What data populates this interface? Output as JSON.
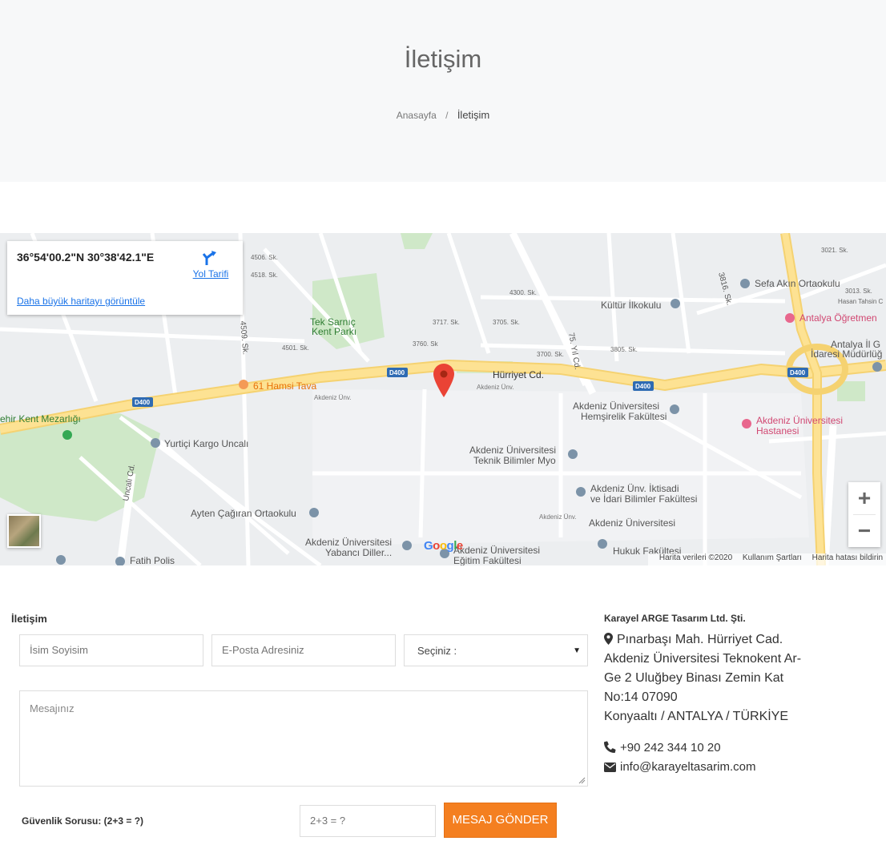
{
  "header": {
    "title": "İletişim",
    "breadcrumb": {
      "home": "Anasayfa",
      "separator": "/",
      "current": "İletişim"
    }
  },
  "map": {
    "coordinates": "36°54'00.2\"N 30°38'42.1\"E",
    "directions_label": "Yol Tarifi",
    "larger_map_link": "Daha büyük haritayı görüntüle",
    "zoom_in": "+",
    "zoom_out": "−",
    "google_logo": "Google",
    "footer": {
      "map_data": "Harita verileri ©2020",
      "terms": "Kullanım Şartları",
      "report": "Harita hatası bildirin"
    },
    "labels": {
      "road_hurriyet": "Hürriyet Cd.",
      "d400": "D400",
      "tek_sarnic": "Tek Sarnıç",
      "kent_parki": "Kent Parkı",
      "hamsi": "61 Hamsi Tava",
      "sefa": "Sefa Akın Ortaokulu",
      "kultur": "Kültür İlkokulu",
      "ogretmen": "Antalya Öğretmen",
      "il_genel": "Antalya İl G",
      "idaresi": "İdaresi Müdürlüğ",
      "hemsirelik_1": "Akdeniz Üniversitesi",
      "hemsirelik_2": "Hemşirelik Fakültesi",
      "hastanesi_1": "Akdeniz Üniversitesi",
      "hastanesi_2": "Hastanesi",
      "teknik_1": "Akdeniz Üniversitesi",
      "teknik_2": "Teknik Bilimler Myo",
      "iktisadi_1": "Akdeniz Ünv. İktisadi",
      "iktisadi_2": "ve İdari Bilimler Fakültesi",
      "hukuk_1": "Akdeniz Üniversitesi",
      "hukuk_2": "Hukuk Fakültesi",
      "yabanci_1": "Akdeniz Üniversitesi",
      "yabanci_2": "Yabancı Diller...",
      "egitim_1": "Akdeniz Üniversitesi",
      "egitim_2": "Eğitim Fakültesi",
      "yurtici": "Yurtiçi Kargo Uncalı",
      "ayten": "Ayten Çağıran Ortaokulu",
      "fatih": "Fatih Polis",
      "mezarlik": "ehir Kent Mezarlığı",
      "uncali": "Uncalı Cd.",
      "sk4509": "4509. Sk.",
      "sk3816": "3816. Sk.",
      "yil75": "75. Yıl Cd.",
      "sk4506": "4506. Sk.",
      "sk4518": "4518. Sk.",
      "sk3760": "3760. Sk",
      "sk3700": "3700. Sk.",
      "sk3805": "3805. Sk.",
      "sk4501": "4501. Sk.",
      "sk3705": "3705. Sk.",
      "sk3717": "3717. Sk.",
      "sk4300": "4300. Sk.",
      "sk3021": "3021. Sk.",
      "sk3013": "3013. Sk.",
      "hasan": "Hasan Tahsin C",
      "akdeniz_unv": "Akdeniz Ünv."
    }
  },
  "form": {
    "heading": "İletişim",
    "name_placeholder": "İsim Soyisim",
    "email_placeholder": "E-Posta Adresiniz",
    "select_value": "Seçiniz :",
    "message_placeholder": "Mesajınız",
    "security_label": "Güvenlik Sorusu: (2+3 = ?)",
    "captcha_placeholder": "2+3 = ?",
    "submit_label": "MESAJ GÖNDER"
  },
  "company": {
    "name": "Karayel ARGE Tasarım Ltd. Şti.",
    "address_line1": "Pınarbaşı Mah. Hürriyet Cad.",
    "address_line2": "Akdeniz Üniversitesi Teknokent Ar-",
    "address_line3": "Ge 2 Uluğbey Binası Zemin Kat",
    "address_line4": "No:14 07090",
    "address_line5": "Konyaaltı / ANTALYA / TÜRKİYE",
    "phone": "+90 242 344 10 20",
    "email": "info@karayeltasarim.com"
  },
  "colors": {
    "accent": "#f47f20",
    "link": "#1a73e8",
    "hero_bg": "#f7f8f9",
    "road": "#fde293",
    "park": "#c8e6c0",
    "pin": "#ea4335"
  },
  "icons": {
    "directions": "directions-icon",
    "pin": "map-pin-icon",
    "location": "location-marker-icon",
    "phone": "phone-icon",
    "email": "envelope-icon"
  }
}
